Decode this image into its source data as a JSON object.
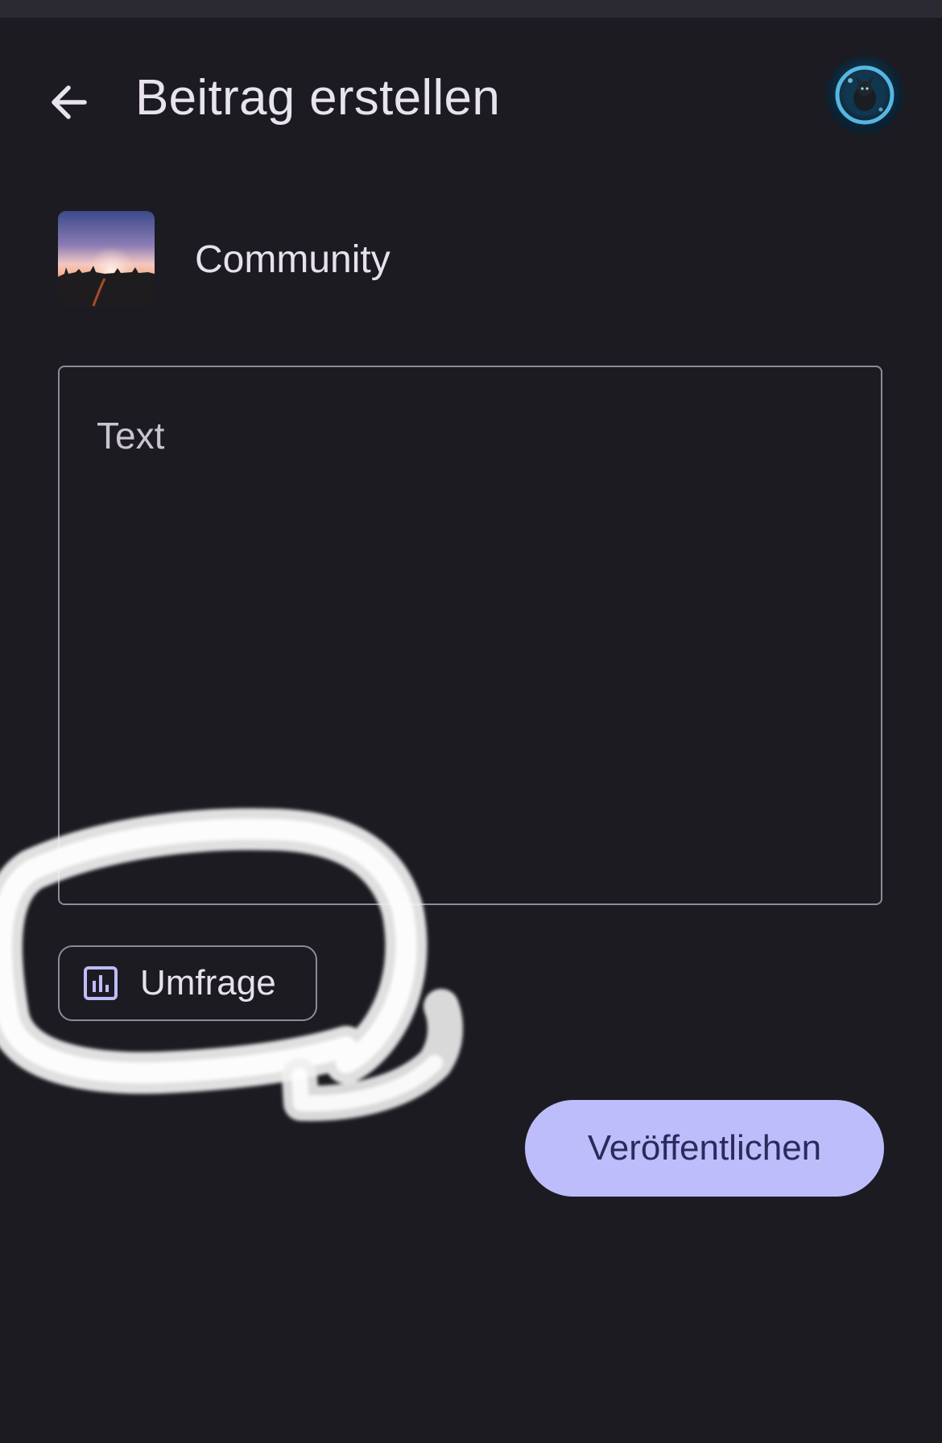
{
  "header": {
    "back_icon": "arrow-left-icon",
    "title": "Beitrag erstellen",
    "avatar_icon": "user-avatar"
  },
  "community": {
    "name": "Community",
    "thumbnail": "community-sunset-thumbnail"
  },
  "composer": {
    "placeholder": "Text",
    "value": ""
  },
  "attachments": {
    "poll_icon": "poll-chart-icon",
    "poll_label": "Umfrage"
  },
  "actions": {
    "publish_label": "Veröffentlichen"
  },
  "colors": {
    "background": "#1d1b22",
    "accent": "#bebdfc",
    "accent_text": "#2b2a5c",
    "outline": "#8f8a96",
    "poll_icon": "#bebdfc",
    "annotation_stroke": "#f2f2f2"
  }
}
